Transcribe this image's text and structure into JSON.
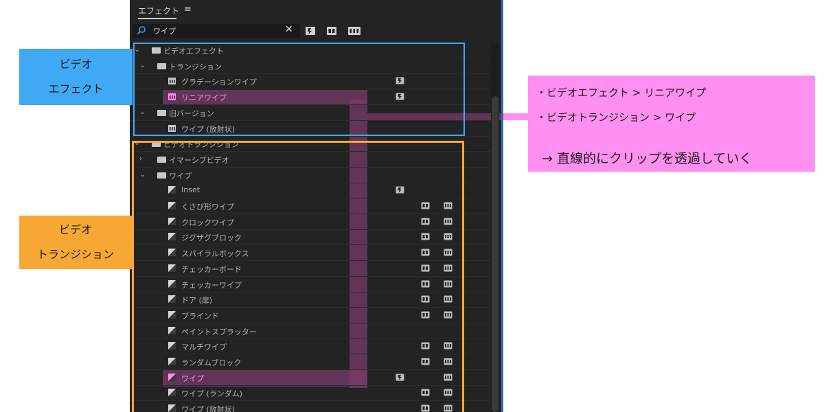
{
  "panel": {
    "tab_label": "エフェクト",
    "tab_menu_glyph": "≡",
    "search_value": "ワイプ",
    "search_clear_glyph": "✕",
    "filter_buttons": [
      "accelerated",
      "32-bit",
      "YUV"
    ]
  },
  "tree": [
    {
      "label": "ビデオエフェクト",
      "kind": "folder",
      "level": 0,
      "expanded": true,
      "badges": []
    },
    {
      "label": "トランジション",
      "kind": "folder",
      "level": 1,
      "expanded": true,
      "badges": []
    },
    {
      "label": "グラデーションワイプ",
      "kind": "effect",
      "level": 2,
      "badges": [
        "accel"
      ]
    },
    {
      "label": "リニアワイプ",
      "kind": "effect",
      "level": 2,
      "badges": [
        "accel"
      ],
      "highlighted": true
    },
    {
      "label": "旧バージョン",
      "kind": "folder",
      "level": 1,
      "expanded": true,
      "badges": []
    },
    {
      "label": "ワイプ (放射状)",
      "kind": "effect",
      "level": 2,
      "badges": []
    },
    {
      "label": "ビデオトランジション",
      "kind": "folder",
      "level": 0,
      "expanded": true,
      "badges": []
    },
    {
      "label": "イマーシブビデオ",
      "kind": "folder",
      "level": 1,
      "expanded": false,
      "badges": []
    },
    {
      "label": "ワイプ",
      "kind": "folder",
      "level": 1,
      "expanded": true,
      "badges": []
    },
    {
      "label": "Inset",
      "kind": "transition",
      "level": 2,
      "badges": [
        "accel"
      ]
    },
    {
      "label": "くさび形ワイプ",
      "kind": "transition",
      "level": 2,
      "badges": [
        "32",
        "yuv"
      ]
    },
    {
      "label": "クロックワイプ",
      "kind": "transition",
      "level": 2,
      "badges": [
        "32",
        "yuv"
      ]
    },
    {
      "label": "ジグザグブロック",
      "kind": "transition",
      "level": 2,
      "badges": [
        "32",
        "yuv"
      ]
    },
    {
      "label": "スパイラルボックス",
      "kind": "transition",
      "level": 2,
      "badges": [
        "32",
        "yuv"
      ]
    },
    {
      "label": "チェッカーボード",
      "kind": "transition",
      "level": 2,
      "badges": [
        "32",
        "yuv"
      ]
    },
    {
      "label": "チェッカーワイプ",
      "kind": "transition",
      "level": 2,
      "badges": [
        "32",
        "yuv"
      ]
    },
    {
      "label": "ドア (扉)",
      "kind": "transition",
      "level": 2,
      "badges": [
        "32",
        "yuv"
      ]
    },
    {
      "label": "ブラインド",
      "kind": "transition",
      "level": 2,
      "badges": [
        "32",
        "yuv"
      ]
    },
    {
      "label": "ペイントスプラッター",
      "kind": "transition",
      "level": 2,
      "badges": []
    },
    {
      "label": "マルチワイプ",
      "kind": "transition",
      "level": 2,
      "badges": [
        "32",
        "yuv"
      ]
    },
    {
      "label": "ランダムブロック",
      "kind": "transition",
      "level": 2,
      "badges": [
        "32",
        "yuv"
      ]
    },
    {
      "label": "ワイプ",
      "kind": "transition",
      "level": 2,
      "badges": [
        "accel",
        "yuv"
      ],
      "highlighted": true
    },
    {
      "label": "ワイプ (ランダム)",
      "kind": "transition",
      "level": 2,
      "badges": [
        "32",
        "yuv"
      ]
    },
    {
      "label": "ワイプ (放射状)",
      "kind": "transition",
      "level": 2,
      "badges": [
        "32",
        "yuv"
      ]
    }
  ],
  "annotations": {
    "video_effects_label_line1": "ビデオ",
    "video_effects_label_line2": "エフェクト",
    "video_transitions_label_line1": "ビデオ",
    "video_transitions_label_line2": "トランジション",
    "callout_line1": "・ビデオエフェクト > リニアワイプ",
    "callout_line2": "・ビデオトランジション > ワイプ",
    "callout_conclusion": "→ 直線的にクリップを透過していく",
    "colors": {
      "panel_bg": "#232323",
      "blue_frame": "#3fa9f5",
      "orange_frame": "#f7a834",
      "callout_pink": "#ff8ff0",
      "highlight_text": "#ff8cf0"
    }
  }
}
